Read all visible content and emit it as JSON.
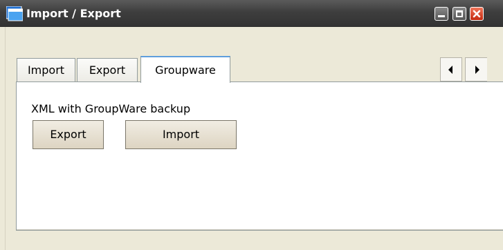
{
  "window": {
    "title": "Import / Export",
    "icon": "window-app-icon",
    "controls": [
      "minimize-icon",
      "maximize-icon",
      "close-icon"
    ]
  },
  "tabs": [
    {
      "label": "Import",
      "selected": false
    },
    {
      "label": "Export",
      "selected": false
    },
    {
      "label": "Groupware",
      "selected": true
    }
  ],
  "tab_scroll": [
    "scroll-left-icon",
    "scroll-right-icon"
  ],
  "groupware_panel": {
    "label": "XML with GroupWare backup",
    "export_button": "Export",
    "import_button": "Import"
  },
  "colors": {
    "titlebar": "#3e3e3e",
    "window_bg": "#ece9d8",
    "tab_accent": "#5e9edd",
    "close_button": "#d6401e"
  }
}
